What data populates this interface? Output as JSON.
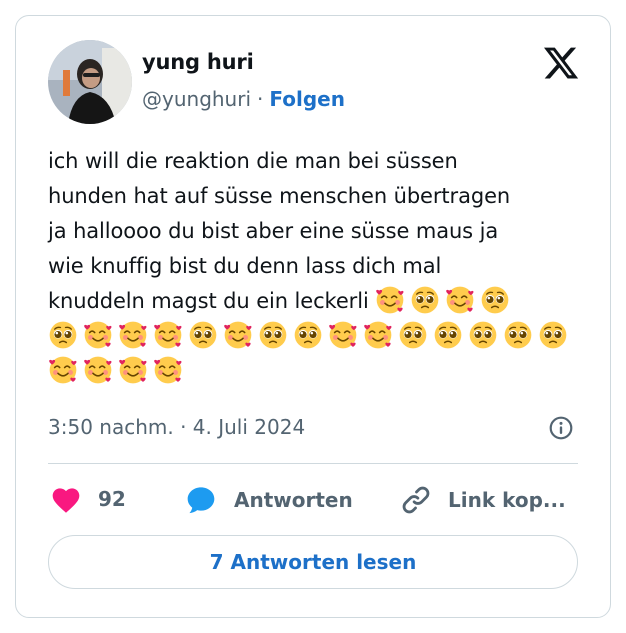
{
  "colors": {
    "accent": "#1d70c8",
    "muted": "#536471",
    "heart": "#f91880",
    "reply": "#1d9bf0",
    "border": "#cfd9de"
  },
  "author": {
    "name": "yung huri",
    "handle": "@yunghuri",
    "follow_label": "Folgen"
  },
  "tweet": {
    "lines": [
      "ich will die reaktion die man bei süssen",
      "hunden hat auf süsse menschen übertragen",
      "ja halloooo du bist aber eine süsse maus ja",
      "wie knuffig bist du denn lass dich mal",
      "knuddeln magst du ein leckerli"
    ],
    "emoji_rows": [
      [
        "smiling-face-with-hearts",
        "pleading-face",
        "smiling-face-with-hearts",
        "pleading-face"
      ],
      [
        "pleading-face",
        "smiling-face-with-hearts",
        "smiling-face-with-hearts",
        "smiling-face-with-hearts",
        "pleading-face",
        "smiling-face-with-hearts",
        "pleading-face",
        "pleading-face",
        "smiling-face-with-hearts",
        "smiling-face-with-hearts",
        "pleading-face",
        "pleading-face",
        "pleading-face",
        "pleading-face",
        "pleading-face"
      ],
      [
        "smiling-face-with-hearts",
        "smiling-face-with-hearts",
        "smiling-face-with-hearts",
        "smiling-face-with-hearts"
      ]
    ],
    "timestamp": "3:50 nachm. · 4. Juli 2024"
  },
  "actions": {
    "like_count": "92",
    "reply_label": "Antworten",
    "copy_label": "Link kop..."
  },
  "read_replies_label": "7 Antworten lesen"
}
